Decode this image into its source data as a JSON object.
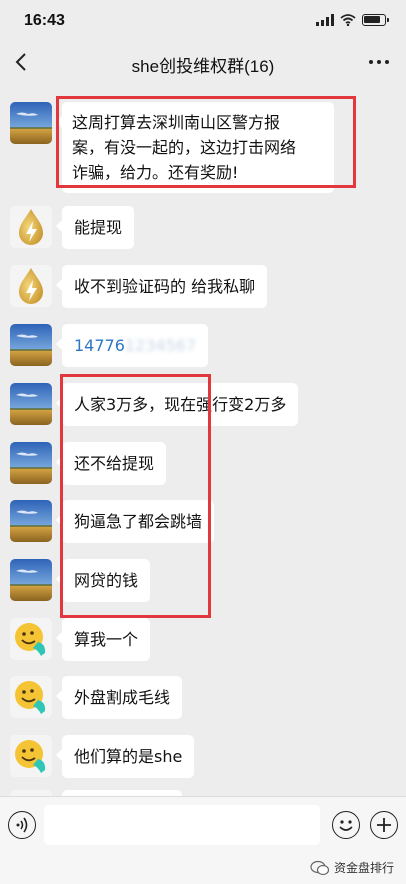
{
  "status_bar": {
    "time": "16:43"
  },
  "nav": {
    "title": "she创投维权群(16)"
  },
  "messages": [
    {
      "avatar": "landscape-avatar",
      "lines": [
        "这周打算去深圳南山区警方报",
        "案，有没一起的，这边打击网络",
        "诈骗，给力。还有奖励!"
      ]
    },
    {
      "avatar": "lightning-drop-avatar",
      "text": "能提现"
    },
    {
      "avatar": "lightning-drop-avatar",
      "text": "收不到验证码的 给我私聊"
    },
    {
      "avatar": "landscape-avatar",
      "text": "14776",
      "text_blurred": "1234567"
    },
    {
      "avatar": "landscape-avatar",
      "text": "人家3万多，现在强行变2万多"
    },
    {
      "avatar": "landscape-avatar",
      "text": "还不给提现"
    },
    {
      "avatar": "landscape-avatar",
      "text": "狗逼急了都会跳墙"
    },
    {
      "avatar": "landscape-avatar",
      "text": "网贷的钱"
    },
    {
      "avatar": "smiley-phone-avatar",
      "text": "算我一个"
    },
    {
      "avatar": "smiley-phone-avatar",
      "text": "外盘割成毛线"
    },
    {
      "avatar": "smiley-phone-avatar",
      "text": "他们算的是she"
    }
  ],
  "watermark": {
    "text": "资金盘排行"
  },
  "colors": {
    "highlight_box": "#e2373c",
    "link": "#2e77c5",
    "background": "#ededed"
  },
  "battery_level": 0.85
}
